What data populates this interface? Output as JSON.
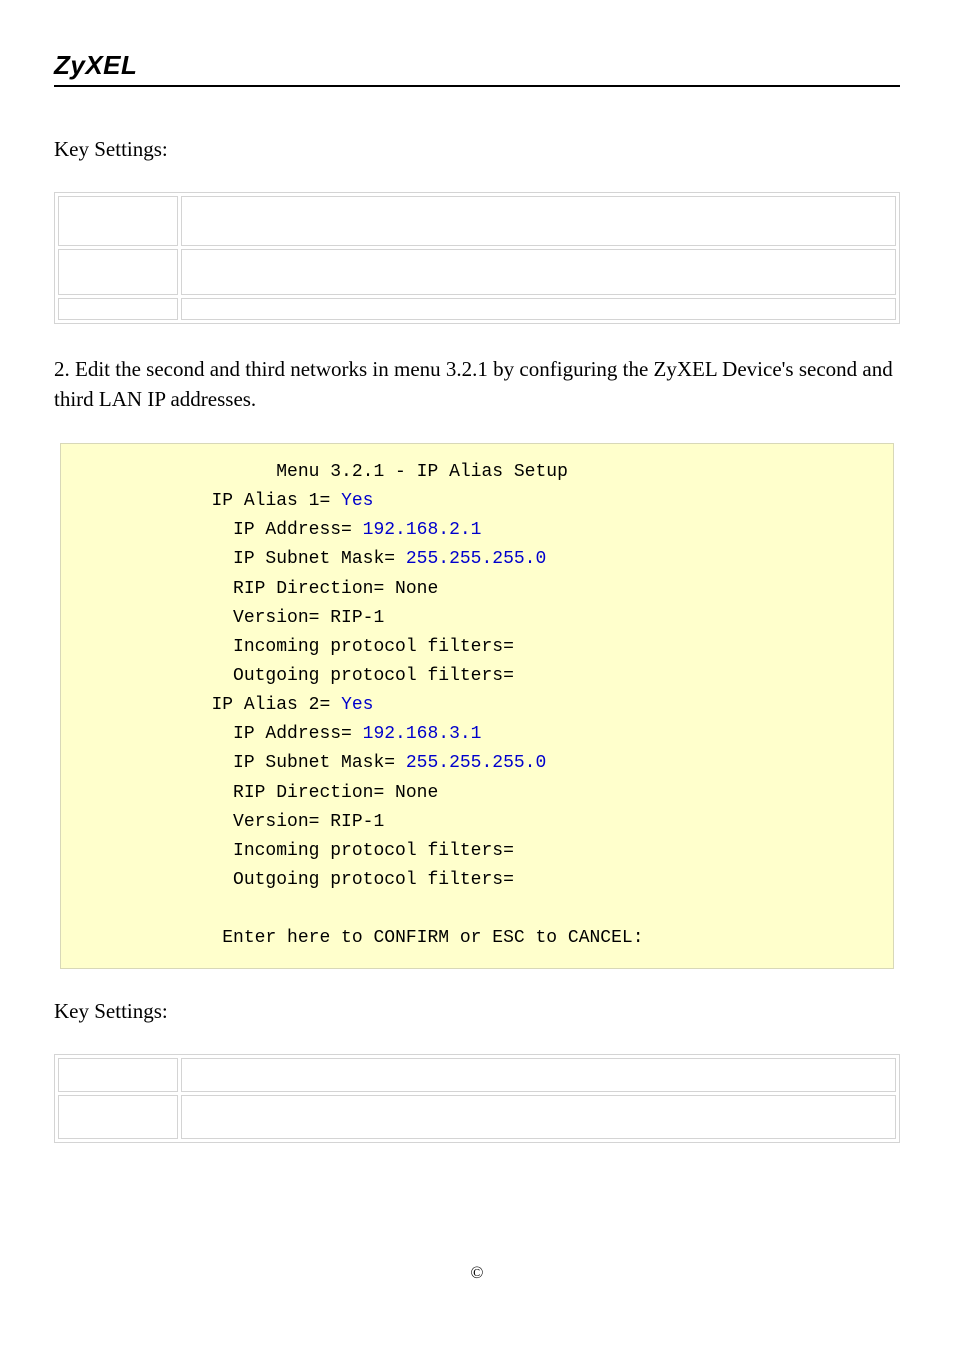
{
  "header": {
    "logo": "ZyXEL"
  },
  "section1": {
    "heading": "Key Settings:"
  },
  "paragraph": "2. Edit the second and third networks in menu 3.2.1 by configuring the ZyXEL Device's second and third LAN IP addresses.",
  "terminal": {
    "title": "Menu 3.2.1 - IP Alias Setup",
    "alias1": {
      "label": "IP Alias 1= ",
      "value": "Yes",
      "ip_label": "IP Address= ",
      "ip_value": "192.168.2.1",
      "mask_label": "IP Subnet Mask= ",
      "mask_value": "255.255.255.0",
      "rip_dir": "RIP Direction= None",
      "version": "Version= RIP-1",
      "in_filters": "Incoming protocol filters=",
      "out_filters": "Outgoing protocol filters="
    },
    "alias2": {
      "label": "IP Alias 2= ",
      "value": "Yes",
      "ip_label": "IP Address= ",
      "ip_value": "192.168.3.1",
      "mask_label": "IP Subnet Mask= ",
      "mask_value": "255.255.255.0",
      "rip_dir": "RIP Direction= None",
      "version": "Version= RIP-1",
      "in_filters": "Incoming protocol filters=",
      "out_filters": "Outgoing protocol filters="
    },
    "footer": "Enter here to CONFIRM or ESC to CANCEL:"
  },
  "section2": {
    "heading": "Key Settings:"
  },
  "page_footer": {
    "copyright": "©"
  }
}
